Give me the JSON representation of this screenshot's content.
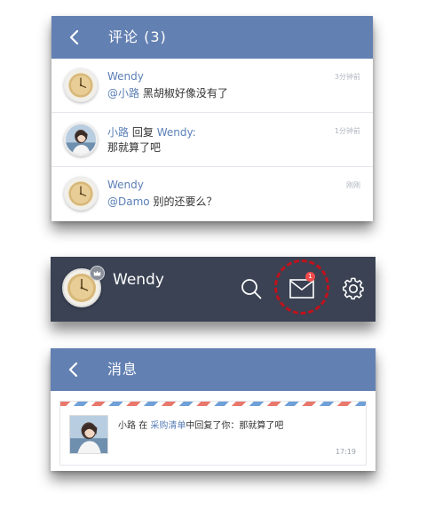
{
  "comments_panel": {
    "title": "评论",
    "count": "(3)",
    "items": [
      {
        "name": "Wendy",
        "mention": "@小路",
        "text": "黑胡椒好像没有了",
        "time": "3分钟前",
        "avatar": "clock"
      },
      {
        "name": "小路",
        "reply_word": "回复",
        "target": "Wendy:",
        "text": "那就算了吧",
        "time": "1分钟前",
        "avatar": "girl"
      },
      {
        "name": "Wendy",
        "mention": "@Damo",
        "text": "别的还要么？",
        "time": "刚刚",
        "avatar": "clock"
      }
    ]
  },
  "profile_bar": {
    "name": "Wendy",
    "mail_badge": "1",
    "icons": [
      "search-icon",
      "mail-icon",
      "gear-icon"
    ]
  },
  "messages_panel": {
    "title": "消息",
    "item": {
      "sender": "小路",
      "word_in": "在",
      "list_name": "采购清单",
      "action": "中回复了你：那就算了吧",
      "time": "17:19"
    }
  },
  "colors": {
    "header_blue": "#6380b2",
    "link_blue": "#5b7fb7",
    "profile_dark": "#3a4253",
    "badge_red": "#f04c4c",
    "highlight_red": "#c0121c"
  }
}
